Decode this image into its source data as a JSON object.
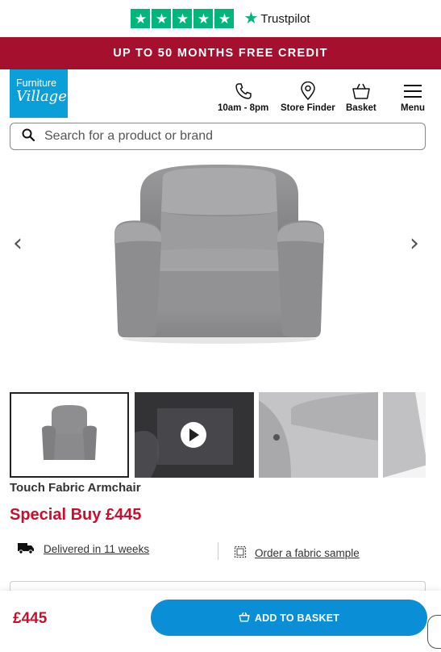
{
  "trustpilot": {
    "brand": "Trustpilot",
    "star_color": "#00b67a"
  },
  "promo": {
    "text": "UP TO 50 MONTHS FREE CREDIT",
    "bg": "#a6102f"
  },
  "header": {
    "logo_line1": "Furniture",
    "logo_line2": "Village",
    "nav": {
      "hours": "10am - 8pm",
      "store_finder": "Store Finder",
      "basket": "Basket",
      "menu": "Menu"
    }
  },
  "search": {
    "placeholder": "Search for a product or brand"
  },
  "product": {
    "title": "Touch Fabric Armchair",
    "price_label": "Special Buy £445",
    "delivery": "Delivered in 11 weeks",
    "sample": "Order a fabric sample"
  },
  "gallery": {
    "thumbnails": [
      "main-product",
      "video",
      "arm-detail",
      "side-detail"
    ]
  },
  "bottom_bar": {
    "price": "£445",
    "add_to_basket": "ADD TO BASKET",
    "button_color": "#0a8fd6"
  }
}
